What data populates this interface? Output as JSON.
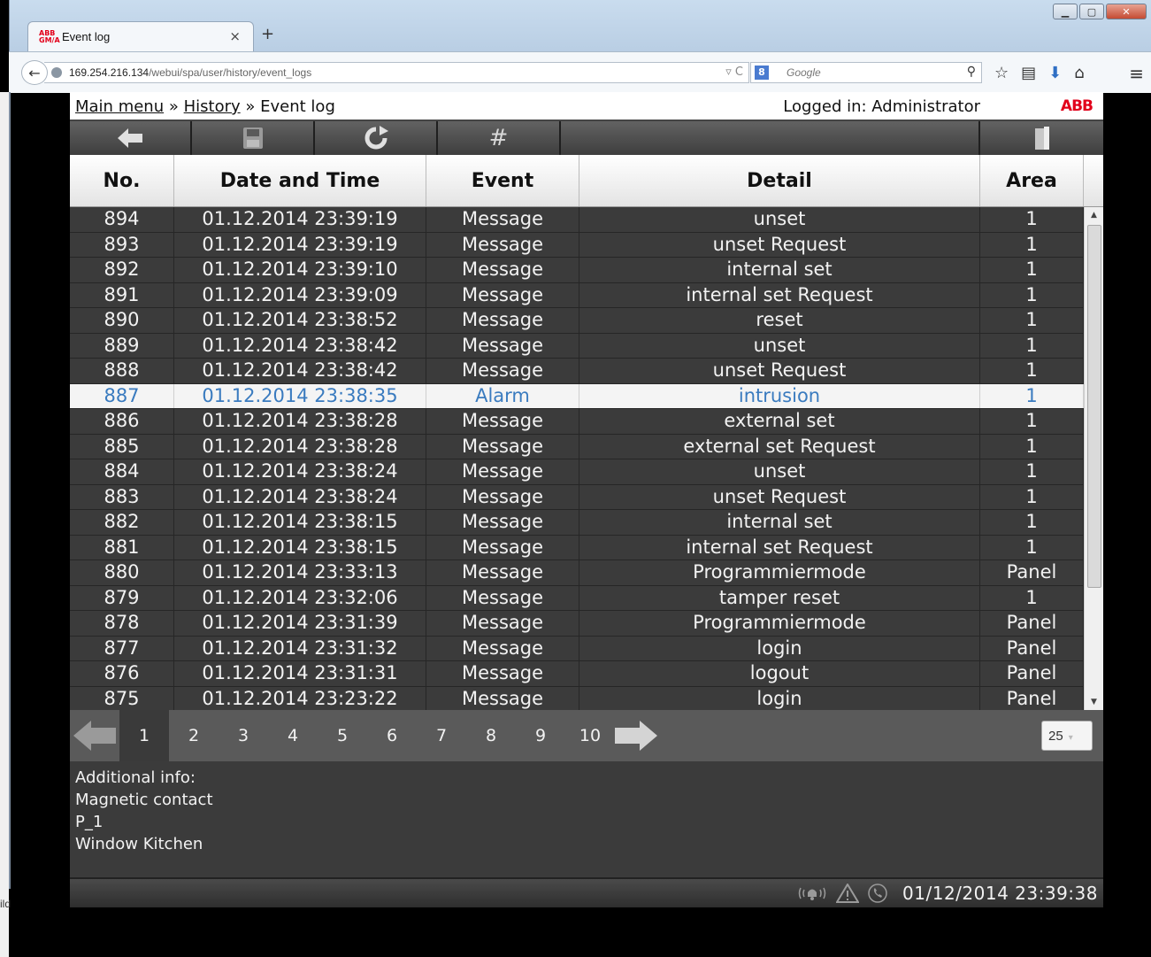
{
  "browser": {
    "tab_title": "Event log",
    "tab_logo": "ABB GM/A",
    "tab_close": "×",
    "new_tab": "+",
    "url_host": "169.254.216.134",
    "url_path": "/webui/spa/user/history/event_logs",
    "search_placeholder": "Google",
    "search_engine": "8"
  },
  "sliver_text": "ild",
  "header": {
    "breadcrumb": [
      "Main menu",
      "History",
      "Event log"
    ],
    "separator": "»",
    "login_status": "Logged in: Administrator",
    "logo": "ABB"
  },
  "toolbar": {
    "icons": [
      "back-arrow-icon",
      "save-icon",
      "refresh-icon",
      "hash-icon",
      "exit-door-icon"
    ]
  },
  "table": {
    "columns": [
      "No.",
      "Date and Time",
      "Event",
      "Detail",
      "Area"
    ],
    "rows": [
      [
        "894",
        "01.12.2014 23:39:19",
        "Message",
        "unset",
        "1"
      ],
      [
        "893",
        "01.12.2014 23:39:19",
        "Message",
        "unset Request",
        "1"
      ],
      [
        "892",
        "01.12.2014 23:39:10",
        "Message",
        "internal set",
        "1"
      ],
      [
        "891",
        "01.12.2014 23:39:09",
        "Message",
        "internal set Request",
        "1"
      ],
      [
        "890",
        "01.12.2014 23:38:52",
        "Message",
        "reset",
        "1"
      ],
      [
        "889",
        "01.12.2014 23:38:42",
        "Message",
        "unset",
        "1"
      ],
      [
        "888",
        "01.12.2014 23:38:42",
        "Message",
        "unset Request",
        "1"
      ],
      [
        "887",
        "01.12.2014 23:38:35",
        "Alarm",
        "intrusion",
        "1"
      ],
      [
        "886",
        "01.12.2014 23:38:28",
        "Message",
        "external set",
        "1"
      ],
      [
        "885",
        "01.12.2014 23:38:28",
        "Message",
        "external set Request",
        "1"
      ],
      [
        "884",
        "01.12.2014 23:38:24",
        "Message",
        "unset",
        "1"
      ],
      [
        "883",
        "01.12.2014 23:38:24",
        "Message",
        "unset Request",
        "1"
      ],
      [
        "882",
        "01.12.2014 23:38:15",
        "Message",
        "internal set",
        "1"
      ],
      [
        "881",
        "01.12.2014 23:38:15",
        "Message",
        "internal set Request",
        "1"
      ],
      [
        "880",
        "01.12.2014 23:33:13",
        "Message",
        "Programmiermode",
        "Panel"
      ],
      [
        "879",
        "01.12.2014 23:32:06",
        "Message",
        "tamper reset",
        "1"
      ],
      [
        "878",
        "01.12.2014 23:31:39",
        "Message",
        "Programmiermode",
        "Panel"
      ],
      [
        "877",
        "01.12.2014 23:31:32",
        "Message",
        "login",
        "Panel"
      ],
      [
        "876",
        "01.12.2014 23:31:31",
        "Message",
        "logout",
        "Panel"
      ],
      [
        "875",
        "01.12.2014 23:23:22",
        "Message",
        "login",
        "Panel"
      ]
    ],
    "selected_row": 7
  },
  "pagination": {
    "pages": [
      "1",
      "2",
      "3",
      "4",
      "5",
      "6",
      "7",
      "8",
      "9",
      "10"
    ],
    "current_page": "1",
    "page_size": "25"
  },
  "info": {
    "lines": [
      "Additional info:",
      "Magnetic contact",
      "P_1",
      "Window Kitchen"
    ]
  },
  "status": {
    "datetime": "01/12/2014 23:39:38",
    "icons": [
      "alarm-bell-icon",
      "warning-triangle-icon",
      "phone-icon"
    ]
  },
  "colors": {
    "selected_text": "#3a7bbf",
    "brand": "#e2001a"
  }
}
